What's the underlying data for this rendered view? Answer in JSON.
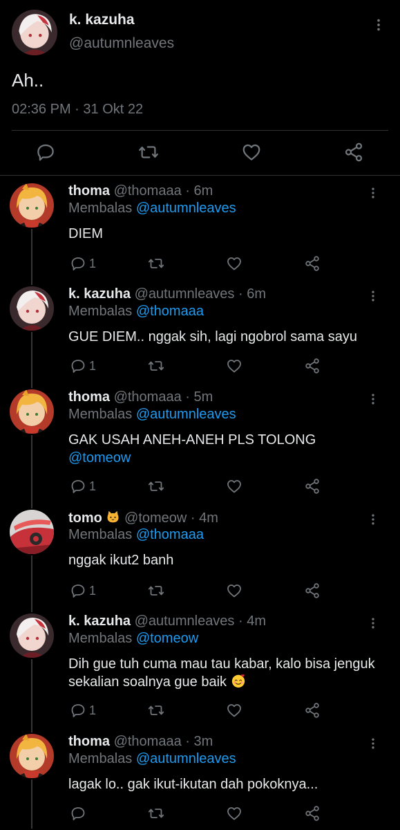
{
  "main_tweet": {
    "name": "k. kazuha",
    "handle": "@autumnleaves",
    "text": "Ah..",
    "time": "02:36 PM",
    "date_sep": " · ",
    "date": "31 Okt 22"
  },
  "replies": [
    {
      "name": "thoma",
      "name_emoji": "",
      "handle": "@thomaaa",
      "time": "6m",
      "replying_prefix": "Membalas ",
      "replying_to": "@autumnleaves",
      "text": "DIEM",
      "text_mention": "",
      "text_emoji": "",
      "reply_count": "1",
      "avatar": "thoma"
    },
    {
      "name": "k. kazuha",
      "name_emoji": "",
      "handle": "@autumnleaves",
      "time": "6m",
      "replying_prefix": "Membalas ",
      "replying_to": "@thomaaa",
      "text": "GUE DIEM.. nggak sih, lagi ngobrol sama sayu",
      "text_mention": "",
      "text_emoji": "",
      "reply_count": "1",
      "avatar": "kazuha"
    },
    {
      "name": "thoma",
      "name_emoji": "",
      "handle": "@thomaaa",
      "time": "5m",
      "replying_prefix": "Membalas ",
      "replying_to": "@autumnleaves",
      "text": "GAK USAH ANEH-ANEH PLS TOLONG",
      "text_mention": "@tomeow",
      "text_emoji": "",
      "reply_count": "1",
      "avatar": "thoma"
    },
    {
      "name": "tomo",
      "name_emoji": "🐱",
      "handle": "@tomeow",
      "time": "4m",
      "replying_prefix": "Membalas ",
      "replying_to": "@thomaaa",
      "text": "nggak ikut2 banh",
      "text_mention": "",
      "text_emoji": "",
      "reply_count": "1",
      "avatar": "tomo"
    },
    {
      "name": "k. kazuha",
      "name_emoji": "",
      "handle": "@autumnleaves",
      "time": "4m",
      "replying_prefix": "Membalas ",
      "replying_to": "@tomeow",
      "text": "Dih gue tuh cuma mau tau kabar, kalo bisa jenguk sekalian soalnya gue baik",
      "text_mention": "",
      "text_emoji": "🥰",
      "reply_count": "1",
      "avatar": "kazuha"
    },
    {
      "name": "thoma",
      "name_emoji": "",
      "handle": "@thomaaa",
      "time": "3m",
      "replying_prefix": "Membalas ",
      "replying_to": "@autumnleaves",
      "text": "lagak lo.. gak ikut-ikutan dah pokoknya...",
      "text_mention": "",
      "text_emoji": "",
      "reply_count": "",
      "avatar": "thoma"
    }
  ],
  "colors": {
    "background": "#000000",
    "text": "#e7e9ea",
    "muted": "#71767b",
    "accent": "#1d9bf0",
    "divider": "#2f3336"
  },
  "icons": [
    "more-vertical-icon",
    "reply-icon",
    "retweet-icon",
    "like-icon",
    "share-icon"
  ]
}
